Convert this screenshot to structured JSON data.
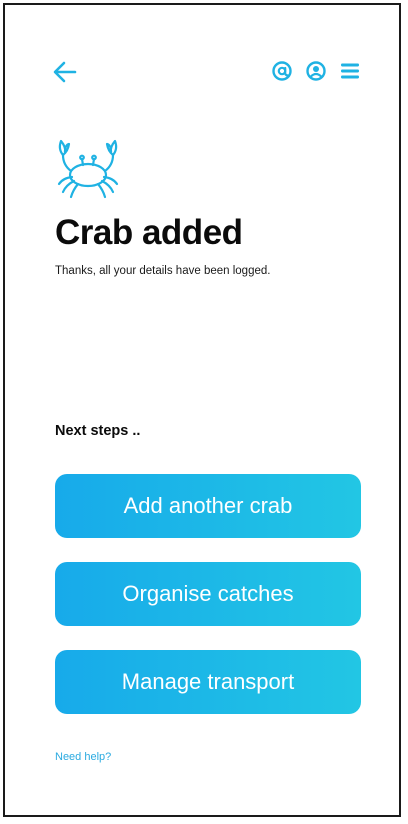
{
  "colors": {
    "accent": "#1fb2e3",
    "button_start": "#17aaea",
    "button_end": "#22c6e4",
    "text": "#0b0b0b",
    "link": "#2aaae0"
  },
  "icons": {
    "back": "arrow-left-icon",
    "top_right": [
      "at-sign-icon",
      "user-circle-icon",
      "hamburger-menu-icon"
    ],
    "hero": "crab-icon"
  },
  "confirmation": {
    "title": "Crab added",
    "subtitle": "Thanks, all your details have been logged."
  },
  "next_steps": {
    "heading": "Next steps ..",
    "buttons": [
      {
        "label": "Add another crab"
      },
      {
        "label": "Organise catches"
      },
      {
        "label": "Manage transport"
      }
    ]
  },
  "help": {
    "label": "Need help?"
  }
}
